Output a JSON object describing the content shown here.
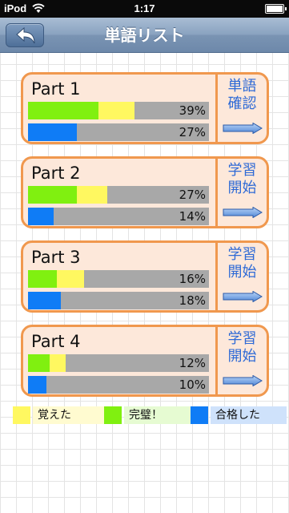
{
  "status_bar": {
    "carrier": "iPod",
    "time": "1:17"
  },
  "nav": {
    "title": "単語リスト",
    "back_icon": "back-arrow-icon"
  },
  "parts": [
    {
      "title": "Part 1",
      "green": 0.39,
      "yellow": 0.2,
      "learned_label": "39%",
      "blue": 0.27,
      "pass_label": "27%",
      "action_line1": "単語",
      "action_line2": "確認"
    },
    {
      "title": "Part 2",
      "green": 0.27,
      "yellow": 0.17,
      "learned_label": "27%",
      "blue": 0.14,
      "pass_label": "14%",
      "action_line1": "学習",
      "action_line2": "開始"
    },
    {
      "title": "Part 3",
      "green": 0.16,
      "yellow": 0.15,
      "learned_label": "16%",
      "blue": 0.18,
      "pass_label": "18%",
      "action_line1": "学習",
      "action_line2": "開始"
    },
    {
      "title": "Part 4",
      "green": 0.12,
      "yellow": 0.09,
      "learned_label": "12%",
      "blue": 0.1,
      "pass_label": "10%",
      "action_line1": "学習",
      "action_line2": "開始"
    }
  ],
  "legend": [
    {
      "label": "覚えた",
      "color": "#fff860",
      "bg": "#fffbd0"
    },
    {
      "label": "完璧！",
      "color": "#80f010",
      "bg": "#e6fbd2"
    },
    {
      "label": "合格した",
      "color": "#0f7cf6",
      "bg": "#cfe2fb"
    }
  ],
  "colors": {
    "accent_orange": "#f0984e",
    "card_bg": "#fde8da",
    "action_text": "#2e6ad6",
    "nav_blue": "#7a94b3"
  }
}
